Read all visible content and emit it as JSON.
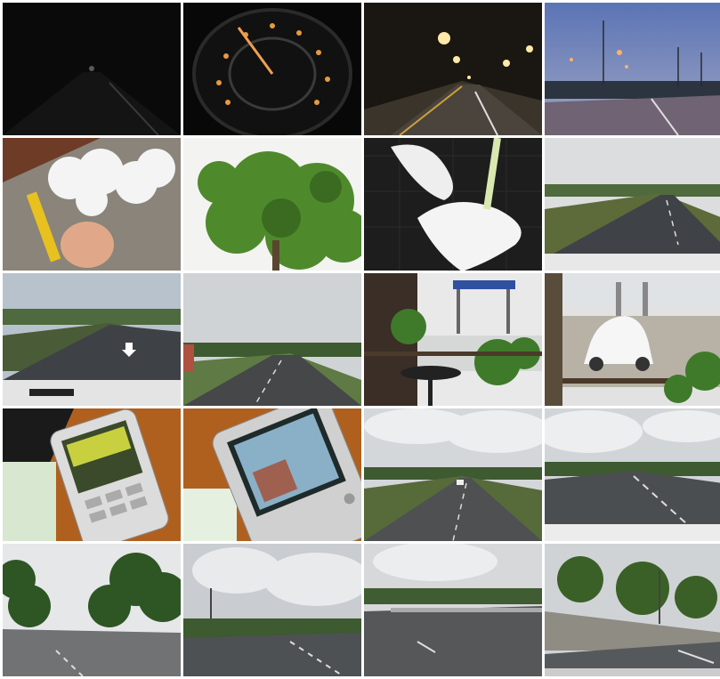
{
  "collage": {
    "rows": 5,
    "columns": 4,
    "tiles": [
      {
        "subject": "night-road"
      },
      {
        "subject": "illuminated-speedometer"
      },
      {
        "subject": "road-with-streetlights-at-dusk"
      },
      {
        "subject": "road-at-dawn-with-lamps"
      },
      {
        "subject": "white-flowers-in-hand"
      },
      {
        "subject": "green-tree-canopy"
      },
      {
        "subject": "white-flower-on-dark-mat"
      },
      {
        "subject": "straight-highway-overcast"
      },
      {
        "subject": "highway-with-arrow-marking"
      },
      {
        "subject": "rural-highway"
      },
      {
        "subject": "cafe-table-near-gas-station"
      },
      {
        "subject": "white-classic-car-at-station"
      },
      {
        "subject": "mobile-phone-on-table"
      },
      {
        "subject": "mobile-phone-screen-closeup"
      },
      {
        "subject": "highway-cloudy-sky"
      },
      {
        "subject": "highway-cloudy-sky-wide"
      },
      {
        "subject": "tree-lined-road"
      },
      {
        "subject": "road-with-pole-and-clouds"
      },
      {
        "subject": "highway-with-guardrail"
      },
      {
        "subject": "road-beside-stone-wall"
      }
    ]
  }
}
